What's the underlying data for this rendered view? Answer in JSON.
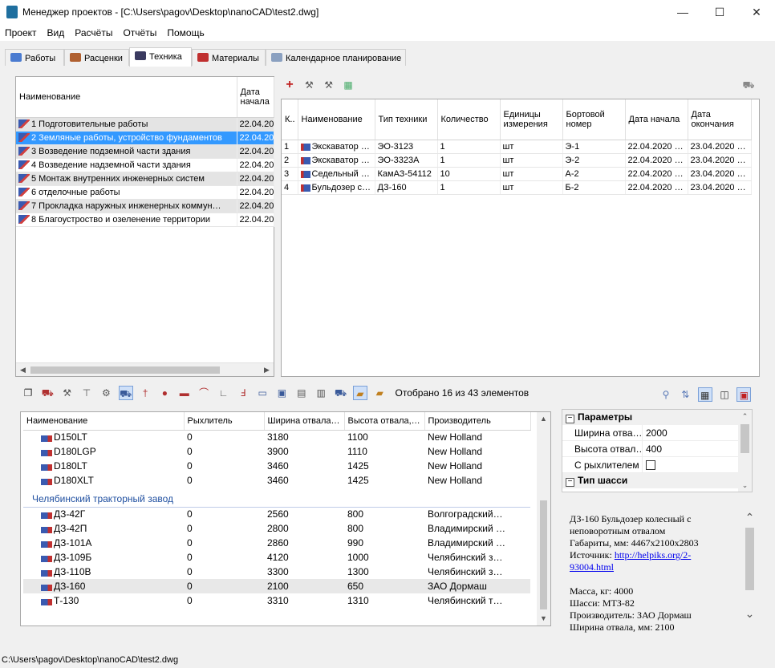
{
  "window": {
    "title": "Менеджер проектов - [C:\\Users\\pagov\\Desktop\\nanoCAD\\test2.dwg]",
    "minimize": "—",
    "maximize": "☐",
    "close": "✕"
  },
  "menu": [
    "Проект",
    "Вид",
    "Расчёты",
    "Отчёты",
    "Помощь"
  ],
  "tabs": [
    "Работы",
    "Расценки",
    "Техника",
    "Материалы",
    "Календарное планирование"
  ],
  "works": {
    "headers": [
      "Наименование",
      "Дата начала"
    ],
    "rows": [
      {
        "name": "1 Подготовительные работы",
        "date": "22.04.20"
      },
      {
        "name": "2 Земляные работы, устройство фундаментов",
        "date": "22.04.20"
      },
      {
        "name": "3 Возведение подземной части здания",
        "date": "22.04.20"
      },
      {
        "name": "4 Возведение надземной части здания",
        "date": "22.04.20"
      },
      {
        "name": "5 Монтаж внутренних инженерных систем",
        "date": "22.04.20"
      },
      {
        "name": "6 отделочные работы",
        "date": "22.04.20"
      },
      {
        "name": "7 Прокладка наружных инженерных коммун…",
        "date": "22.04.20"
      },
      {
        "name": "8 Благоустроство и озеленение территории",
        "date": "22.04.20"
      }
    ]
  },
  "equipment": {
    "headers": [
      "К..",
      "Наименование",
      "Тип техники",
      "Количество",
      "Единицы измерения",
      "Бортовой номер",
      "Дата начала",
      "Дата окончания"
    ],
    "rows": [
      [
        "1",
        "Экскаватор …",
        "ЭО-3123",
        "1",
        "шт",
        "Э-1",
        "22.04.2020 …",
        "23.04.2020 …"
      ],
      [
        "2",
        "Экскаватор …",
        "ЭО-3323А",
        "1",
        "шт",
        "Э-2",
        "22.04.2020 …",
        "23.04.2020 …"
      ],
      [
        "3",
        "Седельный …",
        "КамАЗ-54112",
        "10",
        "шт",
        "А-2",
        "22.04.2020 …",
        "23.04.2020 …"
      ],
      [
        "4",
        "Бульдозер с…",
        "ДЗ-160",
        "1",
        "шт",
        "Б-2",
        "22.04.2020 …",
        "23.04.2020 …"
      ]
    ]
  },
  "filter_text": "Отобрано 16 из 43 элементов",
  "catalog": {
    "headers": [
      "Наименование",
      "Рыхлитель",
      "Ширина отвала…",
      "Высота отвала,…",
      "Производитель"
    ],
    "rows_a": [
      [
        "D150LT",
        "0",
        "3180",
        "1100",
        "New Holland"
      ],
      [
        "D180LGP",
        "0",
        "3900",
        "1110",
        "New Holland"
      ],
      [
        "D180LT",
        "0",
        "3460",
        "1425",
        "New Holland"
      ],
      [
        "D180XLT",
        "0",
        "3460",
        "1425",
        "New Holland"
      ]
    ],
    "group": "Челябинский тракторный завод",
    "rows_b": [
      [
        "ДЗ-42Г",
        "0",
        "2560",
        "800",
        "Волгоградский…"
      ],
      [
        "ДЗ-42П",
        "0",
        "2800",
        "800",
        "Владимирский …"
      ],
      [
        "ДЗ-101А",
        "0",
        "2860",
        "990",
        "Владимирский …"
      ],
      [
        "ДЗ-109Б",
        "0",
        "4120",
        "1000",
        "Челябинский з…"
      ],
      [
        "ДЗ-110В",
        "0",
        "3300",
        "1300",
        "Челябинский з…"
      ],
      [
        "ДЗ-160",
        "0",
        "2100",
        "650",
        "ЗАО Дормаш"
      ],
      [
        "Т-130",
        "0",
        "3310",
        "1310",
        "Челябинский т…"
      ]
    ]
  },
  "props": {
    "section1": "Параметры",
    "rows": [
      {
        "label": "Ширина отва…",
        "value": "2000"
      },
      {
        "label": "Высота отвал…",
        "value": "400"
      },
      {
        "label": "С рыхлителем",
        "value": ""
      }
    ],
    "section2": "Тип шасси"
  },
  "desc": {
    "line1": "ДЗ-160 Бульдозер колесный с",
    "line2": "неповоротным отвалом",
    "line3": "Габариты, мм: 4467х2100х2803",
    "source_label": "Источник: ",
    "source_link": "http://helpiks.org/2-93004.html",
    "line5": "Масса, кг: 4000",
    "line6": "Шасси: МТЗ-82",
    "line7": "Производитель: ЗАО Дормаш",
    "line8": "Ширина отвала, мм: 2100"
  },
  "status": "C:\\Users\\pagov\\Desktop\\nanoCAD\\test2.dwg"
}
